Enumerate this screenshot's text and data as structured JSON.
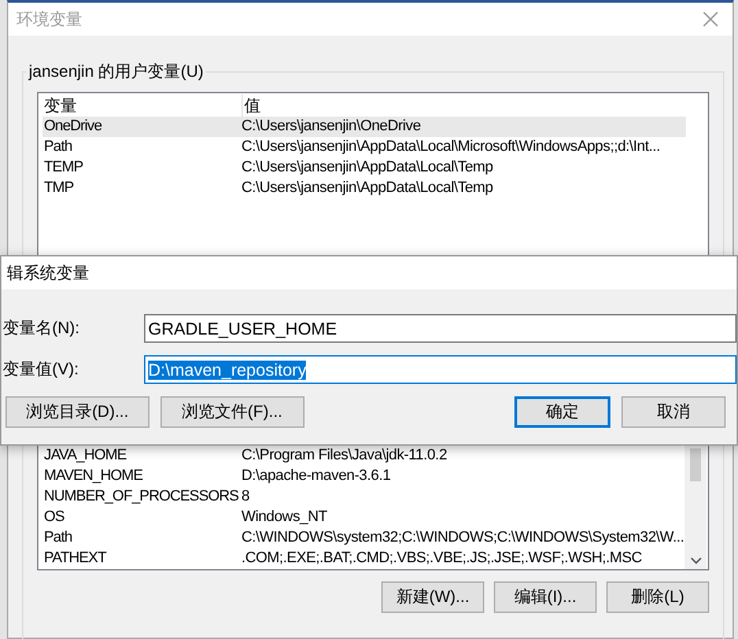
{
  "window": {
    "title": "环境变量"
  },
  "user_variables": {
    "label": "jansenjin 的用户变量(U)",
    "columns": [
      "变量",
      "值"
    ],
    "rows": [
      {
        "name": "OneDrive",
        "value": "C:\\Users\\jansenjin\\OneDrive",
        "selected": true
      },
      {
        "name": "Path",
        "value": "C:\\Users\\jansenjin\\AppData\\Local\\Microsoft\\WindowsApps;;d:\\Int...",
        "selected": false
      },
      {
        "name": "TEMP",
        "value": "C:\\Users\\jansenjin\\AppData\\Local\\Temp",
        "selected": false
      },
      {
        "name": "TMP",
        "value": "C:\\Users\\jansenjin\\AppData\\Local\\Temp",
        "selected": false
      }
    ]
  },
  "system_variables": {
    "rows": [
      {
        "name": "JAVA_HOME",
        "value": "C:\\Program Files\\Java\\jdk-11.0.2"
      },
      {
        "name": "MAVEN_HOME",
        "value": "D:\\apache-maven-3.6.1"
      },
      {
        "name": "NUMBER_OF_PROCESSORS",
        "value": "8"
      },
      {
        "name": "OS",
        "value": "Windows_NT"
      },
      {
        "name": "Path",
        "value": "C:\\WINDOWS\\system32;C:\\WINDOWS;C:\\WINDOWS\\System32\\W..."
      },
      {
        "name": "PATHEXT",
        "value": ".COM;.EXE;.BAT;.CMD;.VBS;.VBE;.JS;.JSE;.WSF;.WSH;.MSC"
      }
    ],
    "buttons": [
      "新建(W)...",
      "编辑(I)...",
      "删除(L)"
    ]
  },
  "edit_dialog": {
    "title": "辑系统变量",
    "fields": [
      {
        "label": "变量名(N):",
        "value": "GRADLE_USER_HOME",
        "focused": false
      },
      {
        "label": "变量值(V):",
        "value": "D:\\maven_repository",
        "focused": true
      }
    ],
    "buttons": [
      {
        "label": "浏览目录(D)...",
        "default": false
      },
      {
        "label": "浏览文件(F)...",
        "default": false
      },
      {
        "label": "确定",
        "default": true
      },
      {
        "label": "取消",
        "default": false
      }
    ]
  }
}
